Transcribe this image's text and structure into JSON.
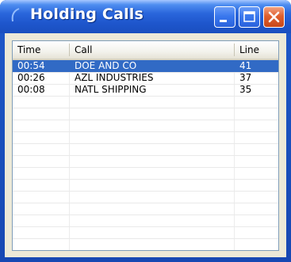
{
  "window": {
    "title": "Holding Calls",
    "accent_color": "#1f58c9",
    "selection_color": "#316ac5"
  },
  "titlebar_buttons": {
    "minimize_icon": "minimize-icon",
    "maximize_icon": "maximize-icon",
    "close_icon": "close-icon"
  },
  "table": {
    "columns": [
      "Time",
      "Call",
      "Line"
    ],
    "rows": [
      {
        "time": "00:54",
        "call": "DOE AND CO",
        "line": "41",
        "selected": true
      },
      {
        "time": "00:26",
        "call": "AZL INDUSTRIES",
        "line": "37",
        "selected": false
      },
      {
        "time": "00:08",
        "call": "NATL SHIPPING",
        "line": "35",
        "selected": false
      }
    ]
  }
}
